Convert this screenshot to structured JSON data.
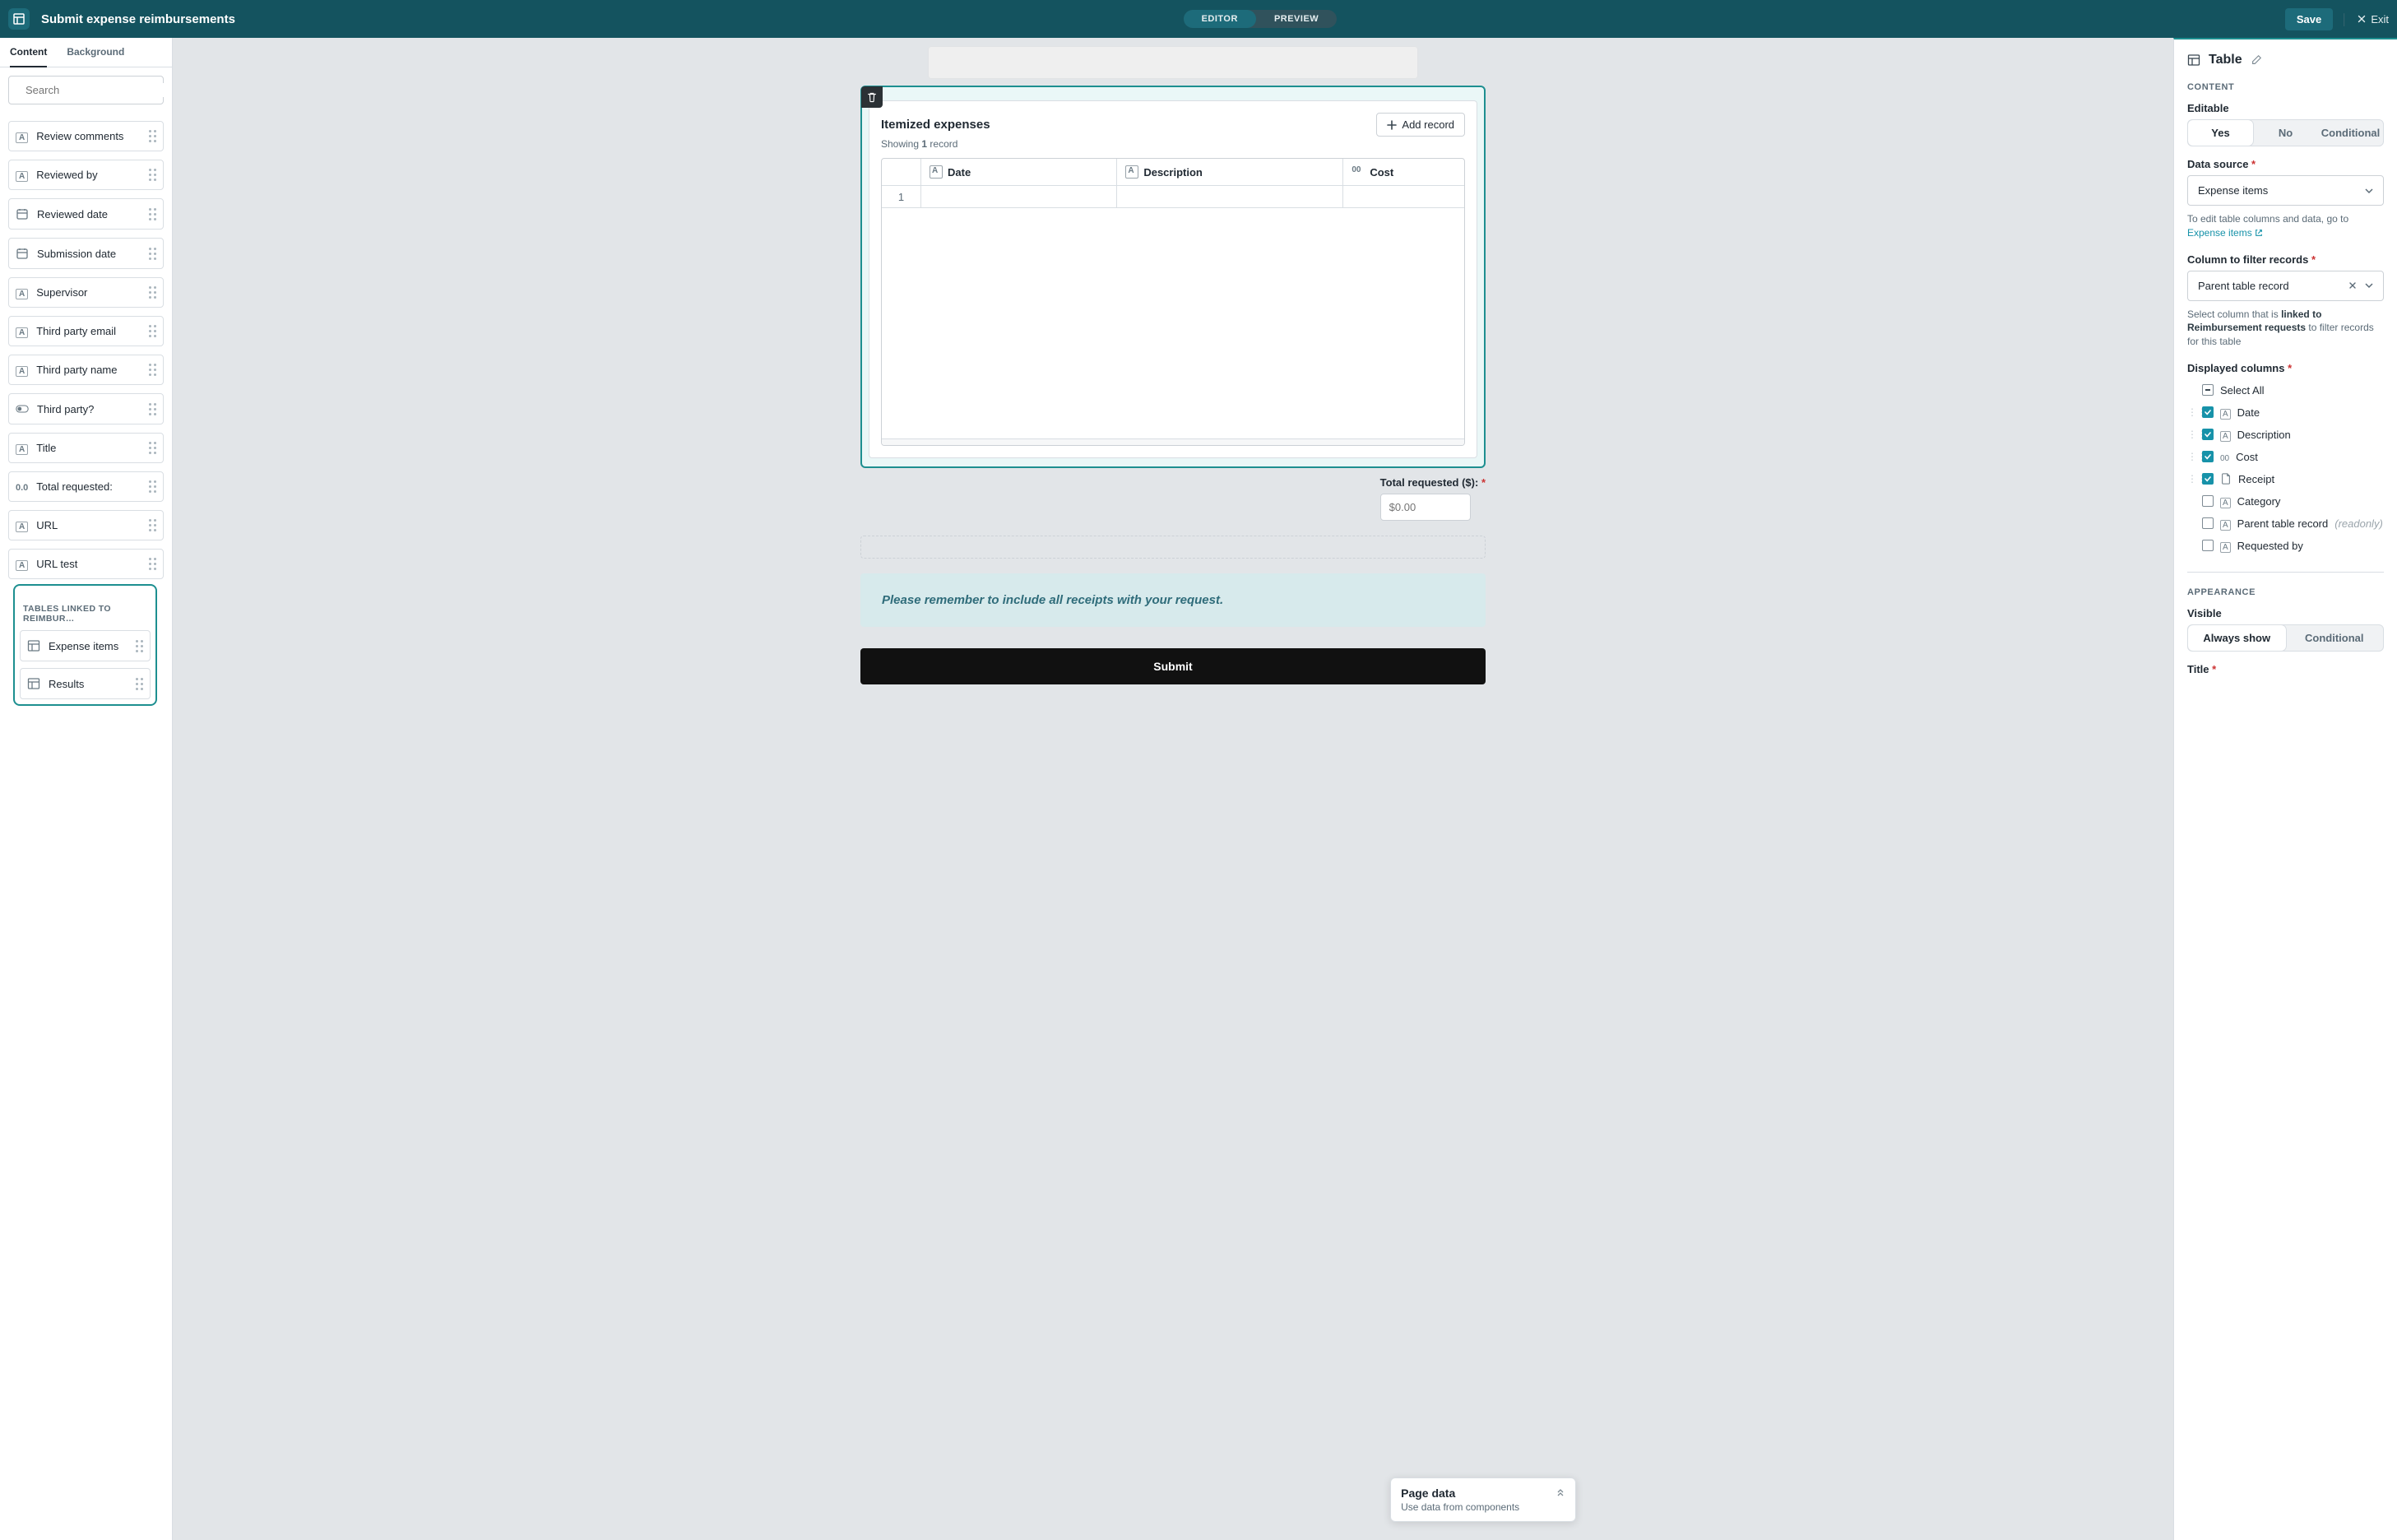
{
  "topbar": {
    "title": "Submit expense reimbursements",
    "editor_label": "EDITOR",
    "preview_label": "PREVIEW",
    "save_label": "Save",
    "exit_label": "Exit"
  },
  "left_tabs": {
    "content": "Content",
    "background": "Background"
  },
  "search": {
    "placeholder": "Search"
  },
  "field_items": [
    {
      "type": "text",
      "label": "Review comments"
    },
    {
      "type": "text",
      "label": "Reviewed by"
    },
    {
      "type": "date",
      "label": "Reviewed date"
    },
    {
      "type": "date",
      "label": "Submission date"
    },
    {
      "type": "text",
      "label": "Supervisor"
    },
    {
      "type": "text",
      "label": "Third party email"
    },
    {
      "type": "text",
      "label": "Third party name"
    },
    {
      "type": "toggle",
      "label": "Third party?"
    },
    {
      "type": "text",
      "label": "Title"
    },
    {
      "type": "number",
      "label": "Total requested:"
    },
    {
      "type": "text",
      "label": "URL"
    },
    {
      "type": "text",
      "label": "URL test"
    }
  ],
  "linked_section": {
    "label": "TABLES LINKED TO REIMBUR…",
    "items": [
      {
        "label": "Expense items"
      },
      {
        "label": "Results"
      }
    ]
  },
  "canvas": {
    "table_title": "Itemized expenses",
    "add_record_label": "Add record",
    "showing_prefix": "Showing ",
    "showing_count": "1",
    "showing_suffix": " record",
    "columns": {
      "date": "Date",
      "description": "Description",
      "cost": "Cost"
    },
    "row_index": "1",
    "total_label": "Total requested ($): ",
    "total_asterisk": "*",
    "total_placeholder": "$0.00",
    "hint": "Please remember to include all receipts with your request.",
    "submit_label": "Submit"
  },
  "page_data_chip": {
    "title": "Page data",
    "subtitle": "Use data from components"
  },
  "right": {
    "panel_title": "Table",
    "section_content": "CONTENT",
    "editable_label": "Editable",
    "editable_options": {
      "yes": "Yes",
      "no": "No",
      "conditional": "Conditional"
    },
    "datasource_label": "Data source ",
    "datasource_asterisk": "*",
    "datasource_value": "Expense items",
    "datasource_help_prefix": "To edit table columns and data, go to ",
    "datasource_help_link": "Expense items",
    "filter_label": "Column to filter records ",
    "filter_asterisk": "*",
    "filter_value": "Parent table record",
    "filter_help_1": "Select column that is ",
    "filter_help_bold": "linked to Reimbursement requests",
    "filter_help_2": " to filter records for this table",
    "displayed_label": "Displayed columns ",
    "displayed_asterisk": "*",
    "select_all_label": "Select All",
    "columns": [
      {
        "label": "Date",
        "kind": "text",
        "checked": true,
        "draggable": true
      },
      {
        "label": "Description",
        "kind": "text",
        "checked": true,
        "draggable": true
      },
      {
        "label": "Cost",
        "kind": "num",
        "checked": true,
        "draggable": true
      },
      {
        "label": "Receipt",
        "kind": "file",
        "checked": true,
        "draggable": true
      },
      {
        "label": "Category",
        "kind": "text",
        "checked": false,
        "draggable": false
      },
      {
        "label": "Parent table record",
        "kind": "text",
        "checked": false,
        "draggable": false,
        "readonly": "(readonly)"
      },
      {
        "label": "Requested by",
        "kind": "text",
        "checked": false,
        "draggable": false
      }
    ],
    "section_appearance": "APPEARANCE",
    "visible_label": "Visible",
    "visible_options": {
      "always": "Always show",
      "conditional": "Conditional"
    },
    "title_label": "Title ",
    "title_asterisk": "*"
  },
  "icons": {
    "text": "A",
    "num": "00",
    "number": "0.0"
  }
}
